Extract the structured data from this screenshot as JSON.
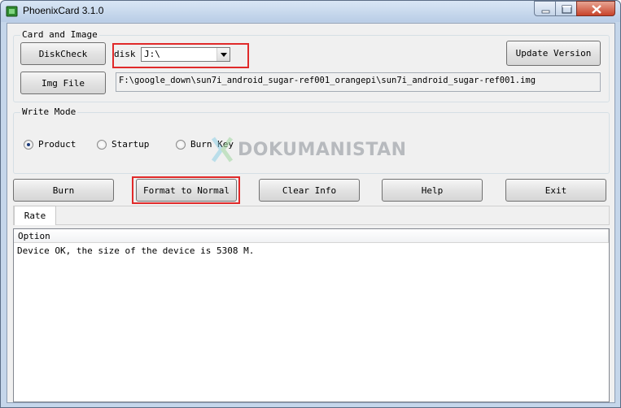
{
  "window": {
    "title": "PhoenixCard 3.1.0"
  },
  "card_and_image": {
    "legend": "Card and Image",
    "diskcheck_label": "DiskCheck",
    "disk_label": "disk",
    "disk_value": "J:\\",
    "update_version_label": "Update Version",
    "img_file_label": "Img File",
    "img_path": "F:\\google_down\\sun7i_android_sugar-ref001_orangepi\\sun7i_android_sugar-ref001.img"
  },
  "write_mode": {
    "legend": "Write Mode",
    "options": [
      {
        "label": "Product",
        "selected": true
      },
      {
        "label": "Startup",
        "selected": false
      },
      {
        "label": "Burn Key",
        "selected": false
      }
    ]
  },
  "actions": {
    "burn": "Burn",
    "format": "Format to Normal",
    "clear": "Clear Info",
    "help": "Help",
    "exit": "Exit"
  },
  "rate_tab": "Rate",
  "output": {
    "column": "Option",
    "lines": [
      "Device OK, the size of the device is 5308 M."
    ]
  },
  "watermark": "DOKUMANISTAN",
  "colors": {
    "highlight": "#e02a2a",
    "frame": "#c5d6ea",
    "close": "#c8432a"
  },
  "icons": [
    "phoenix-app-icon",
    "minimize-icon",
    "maximize-icon",
    "close-icon",
    "dropdown-arrow-icon"
  ]
}
